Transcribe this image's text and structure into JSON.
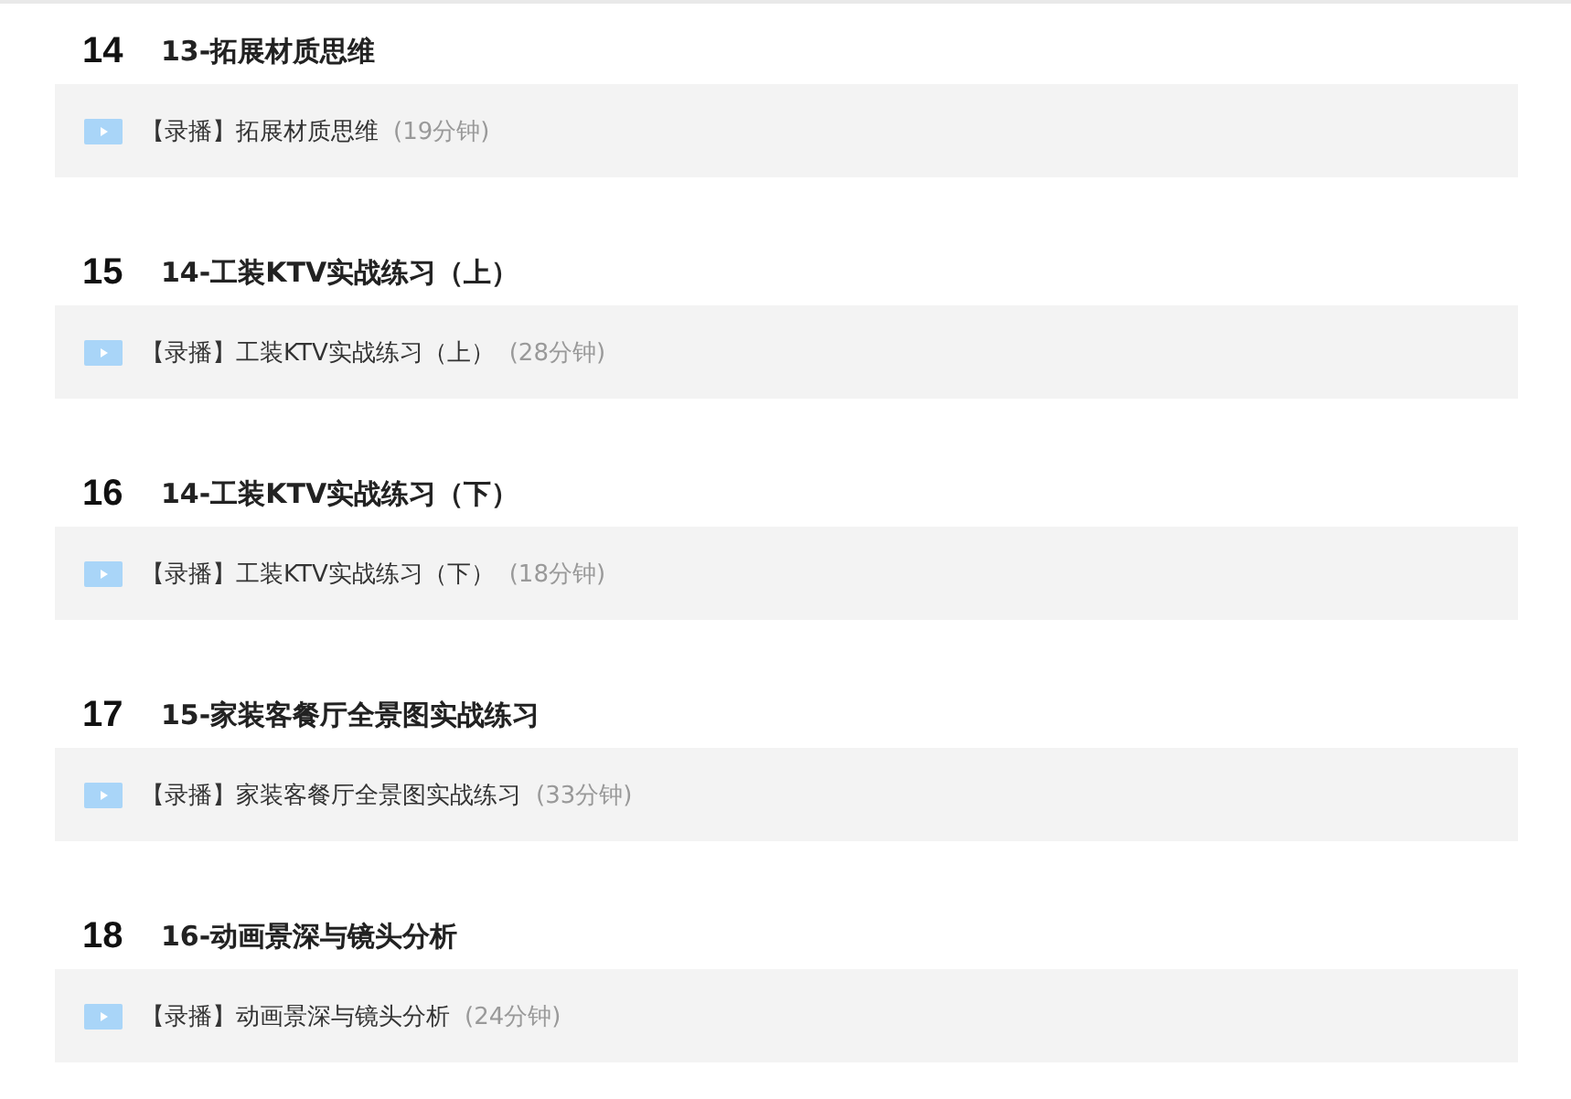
{
  "lessons": [
    {
      "number": "14",
      "title": "13-拓展材质思维",
      "items": [
        {
          "tag": "【录播】",
          "title": "拓展材质思维",
          "duration": "(19分钟)"
        }
      ]
    },
    {
      "number": "15",
      "title": "14-工装KTV实战练习（上）",
      "items": [
        {
          "tag": "【录播】",
          "title": "工装KTV实战练习（上）",
          "duration": "(28分钟)"
        }
      ]
    },
    {
      "number": "16",
      "title": "14-工装KTV实战练习（下）",
      "items": [
        {
          "tag": "【录播】",
          "title": "工装KTV实战练习（下）",
          "duration": "(18分钟)"
        }
      ]
    },
    {
      "number": "17",
      "title": "15-家装客餐厅全景图实战练习",
      "items": [
        {
          "tag": "【录播】",
          "title": "家装客餐厅全景图实战练习",
          "duration": "(33分钟)"
        }
      ]
    },
    {
      "number": "18",
      "title": "16-动画景深与镜头分析",
      "items": [
        {
          "tag": "【录播】",
          "title": "动画景深与镜头分析",
          "duration": "(24分钟)"
        }
      ]
    }
  ]
}
